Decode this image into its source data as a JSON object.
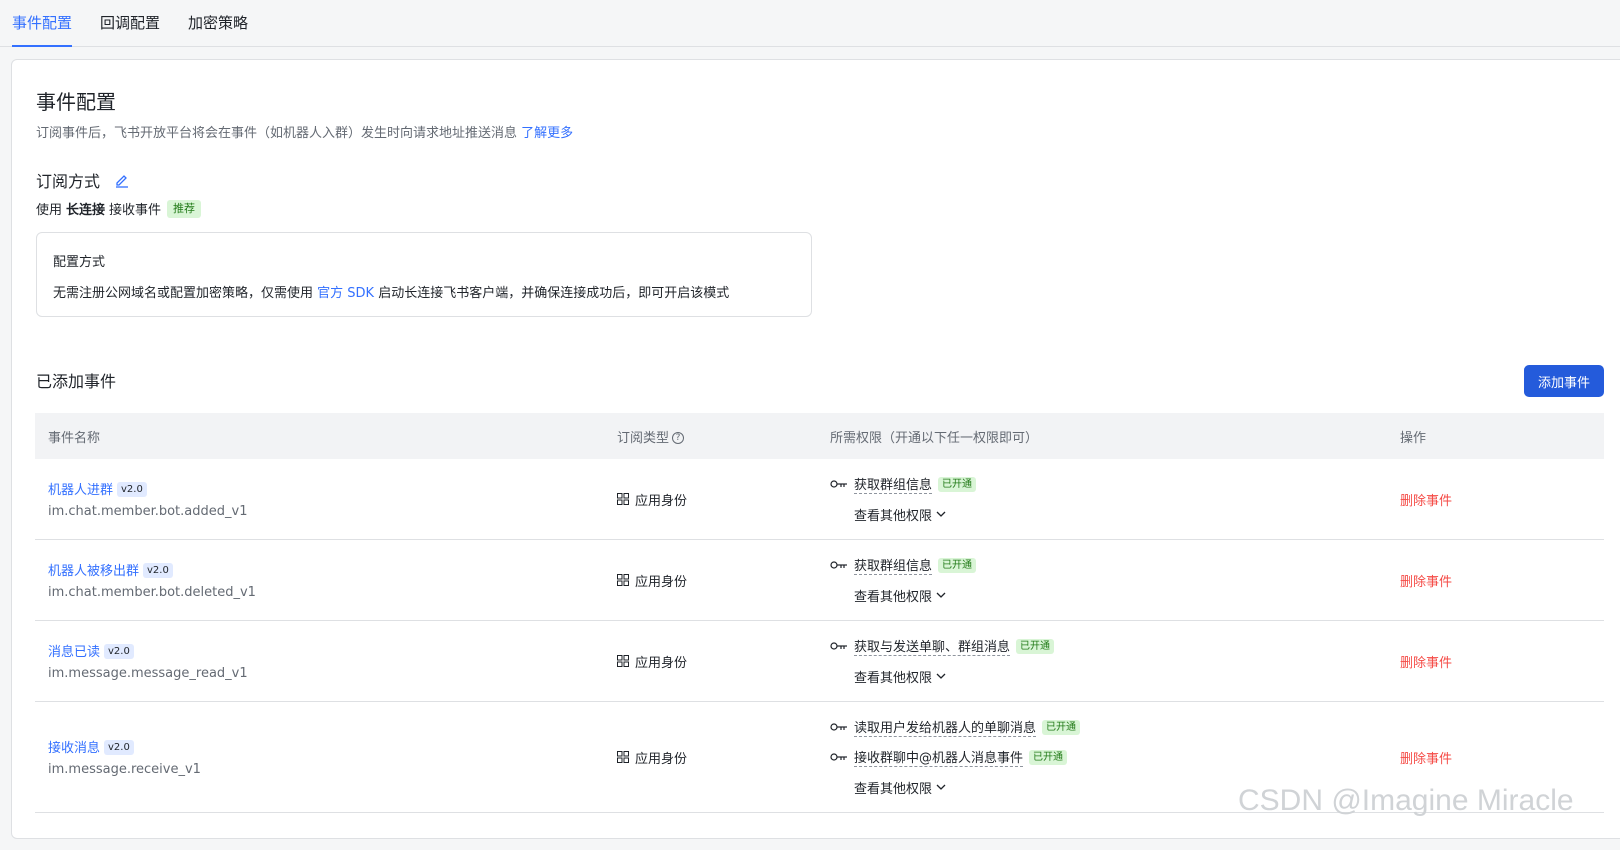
{
  "tabs": [
    {
      "label": "事件配置"
    },
    {
      "label": "回调配置"
    },
    {
      "label": "加密策略"
    }
  ],
  "page": {
    "title": "事件配置",
    "subtitle": "订阅事件后，飞书开放平台将会在事件（如机器人入群）发生时向请求地址推送消息",
    "learn_more": "了解更多"
  },
  "subscription": {
    "heading": "订阅方式",
    "mode_prefix": "使用",
    "mode_name": "长连接",
    "mode_suffix": "接收事件",
    "recommend_tag": "推荐",
    "config_title": "配置方式",
    "config_desc_prefix": "无需注册公网域名或配置加密策略，仅需使用",
    "config_desc_link": "官方 SDK",
    "config_desc_suffix": "启动长连接飞书客户端，并确保连接成功后，即可开启该模式"
  },
  "events_section": {
    "title": "已添加事件",
    "add_button": "添加事件",
    "columns": {
      "name": "事件名称",
      "type": "订阅类型",
      "perms": "所需权限（开通以下任一权限即可）",
      "ops": "操作"
    }
  },
  "events": [
    {
      "name": "机器人进群",
      "version": "v2.0",
      "key": "im.chat.member.bot.added_v1",
      "identity": "应用身份",
      "permissions": [
        {
          "label": "获取群组信息",
          "status": "已开通"
        }
      ],
      "more": "查看其他权限",
      "delete": "删除事件"
    },
    {
      "name": "机器人被移出群",
      "version": "v2.0",
      "key": "im.chat.member.bot.deleted_v1",
      "identity": "应用身份",
      "permissions": [
        {
          "label": "获取群组信息",
          "status": "已开通"
        }
      ],
      "more": "查看其他权限",
      "delete": "删除事件"
    },
    {
      "name": "消息已读",
      "version": "v2.0",
      "key": "im.message.message_read_v1",
      "identity": "应用身份",
      "permissions": [
        {
          "label": "获取与发送单聊、群组消息",
          "status": "已开通"
        }
      ],
      "more": "查看其他权限",
      "delete": "删除事件"
    },
    {
      "name": "接收消息",
      "version": "v2.0",
      "key": "im.message.receive_v1",
      "identity": "应用身份",
      "permissions": [
        {
          "label": "读取用户发给机器人的单聊消息",
          "status": "已开通"
        },
        {
          "label": "接收群聊中@机器人消息事件",
          "status": "已开通"
        }
      ],
      "more": "查看其他权限",
      "delete": "删除事件"
    }
  ],
  "watermark": "CSDN @Imagine Miracle",
  "colors": {
    "accent": "#3370ff",
    "primary_button": "#245bdb",
    "danger": "#f54a45",
    "success_bg": "#d9f5d6",
    "success_text": "#237b19"
  }
}
